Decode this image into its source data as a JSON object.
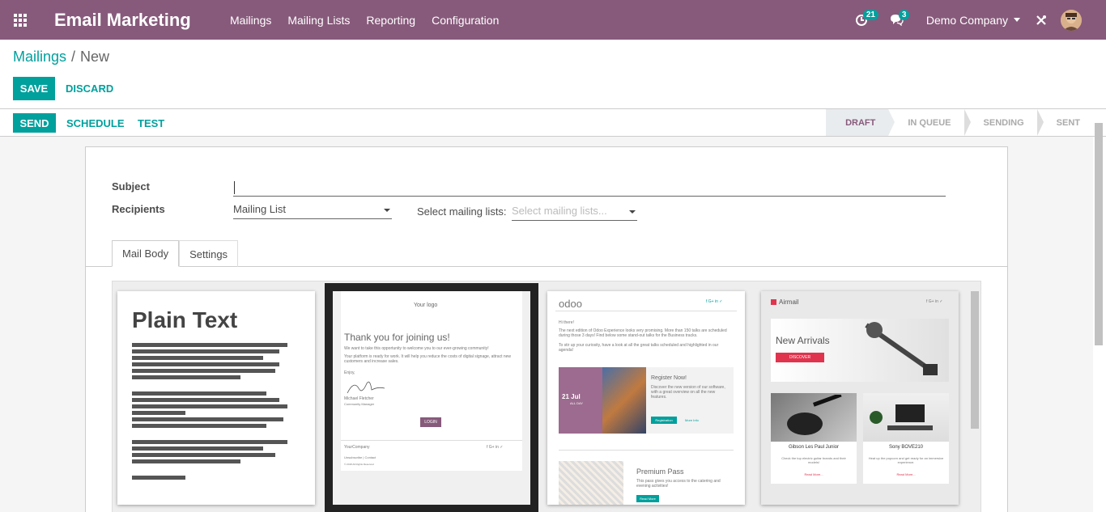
{
  "app": {
    "title": "Email Marketing"
  },
  "menu": [
    "Mailings",
    "Mailing Lists",
    "Reporting",
    "Configuration"
  ],
  "nav": {
    "activity_count": "21",
    "message_count": "3",
    "company": "Demo Company"
  },
  "breadcrumb": {
    "parent": "Mailings",
    "separator": "/",
    "current": "New"
  },
  "actions": {
    "save": "SAVE",
    "discard": "DISCARD"
  },
  "status_actions": {
    "send": "SEND",
    "schedule": "SCHEDULE",
    "test": "TEST"
  },
  "stages": [
    "DRAFT",
    "IN QUEUE",
    "SENDING",
    "SENT"
  ],
  "active_stage": "DRAFT",
  "form": {
    "subject_label": "Subject",
    "subject_value": "",
    "recipients_label": "Recipients",
    "recipients_value": "Mailing List",
    "mailing_lists_label": "Select mailing lists:",
    "mailing_lists_placeholder": "Select mailing lists..."
  },
  "tabs": [
    "Mail Body",
    "Settings"
  ],
  "templates": {
    "plain": {
      "title": "Plain Text"
    },
    "welcome": {
      "logo": "Your logo",
      "heading": "Thank you for joining us!",
      "p1": "We want to take this opportunity to welcome you to our ever-growing community!",
      "p2": "Your platform is ready for work. It will help you reduce the costs of digital signage, attract new customers and increase sales.",
      "regards": "Enjoy,",
      "signer": "Michael Fletcher",
      "role": "Community Manager",
      "button": "LOGIN",
      "company": "YourCompany",
      "links": "Unsubscribe | Contact",
      "copyright": "© 2018 All Rights Reserved"
    },
    "event": {
      "brand": "odoo",
      "greeting": "Hi there!",
      "p1": "The next edition of Odoo Experience looks very promising. More than 150 talks are scheduled during those 3 days! Find below some stand-out talks for the Business tracks.",
      "p2": "To stir up your curiosity, have a look at all the great talks scheduled and highlighted in our agenda!",
      "date": "21 Jul",
      "allday": "ALL DAY",
      "register": "Register Now!",
      "desc": "Discover the new version of our software, with a great overview on all the new features.",
      "reg_btn": "Registration",
      "more": "More Info",
      "premium": "Premium Pass",
      "premium_desc": "This pass gives you access to the catering and evening activities!",
      "read": "Read More"
    },
    "airmail": {
      "brand": "Airmail",
      "hero": "New Arrivals",
      "discover": "DISCOVER",
      "p1_name": "Gibson Les Paul Junior",
      "p1_desc": "Check the top electric guitar brands and their models!",
      "p2_name": "Sony BOVE210",
      "p2_desc": "Heat up the popcorn and get ready for an immersive experience.",
      "read": "Read More..."
    }
  },
  "colors": {
    "brand": "#875a7b",
    "accent": "#00a09d"
  }
}
